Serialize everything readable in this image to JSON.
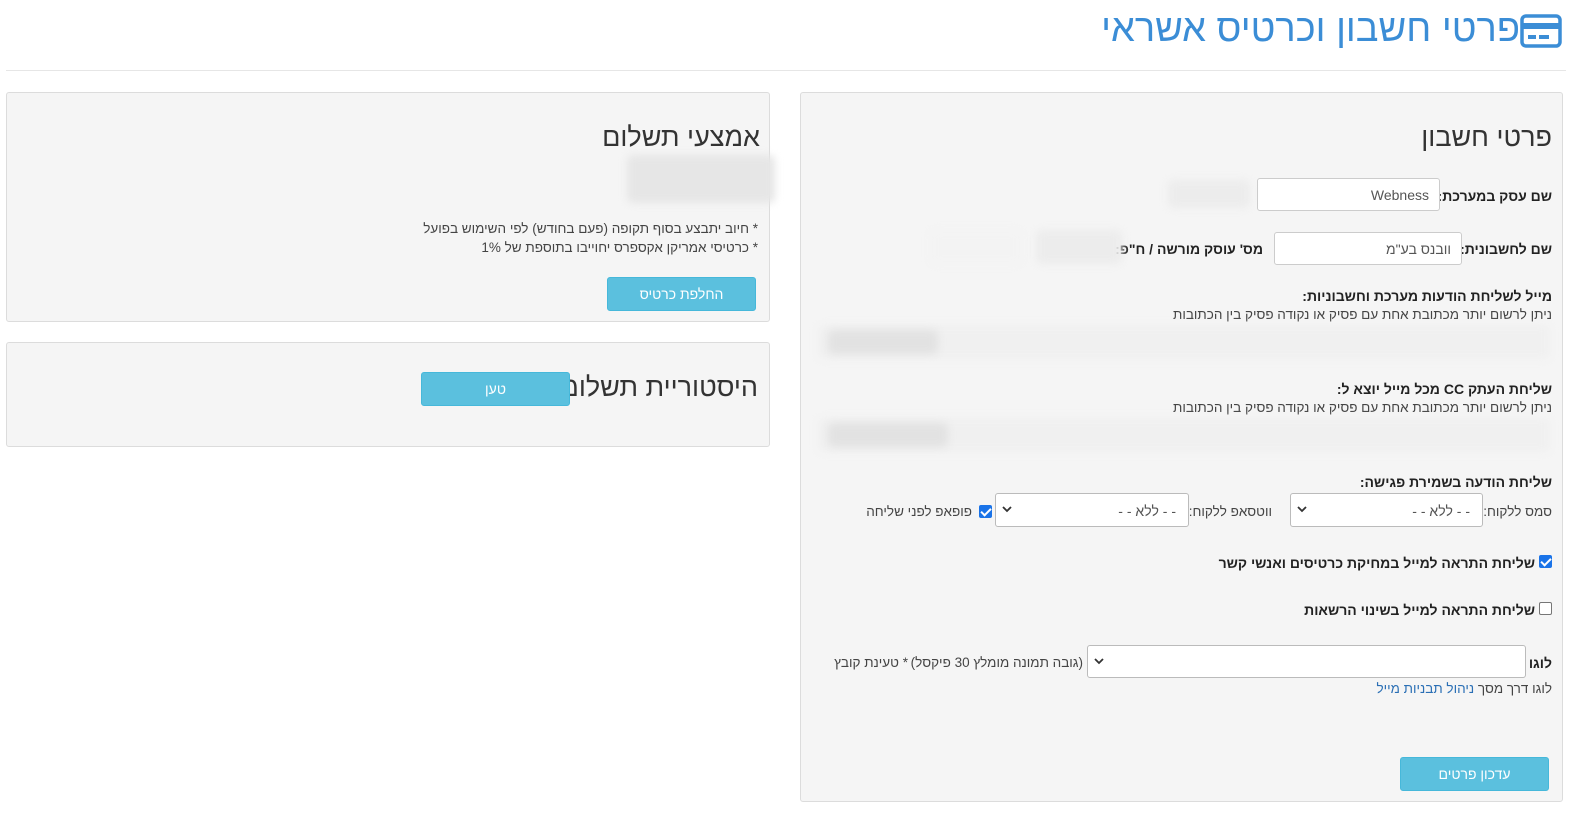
{
  "header": {
    "title": "פרטי חשבון וכרטיס אשראי",
    "icon": "credit-card-icon",
    "accent_color": "#3b8dd6"
  },
  "account_panel": {
    "title": "פרטי חשבון",
    "business_name_label": "שם עסק במערכת:",
    "business_name_value": "Webness",
    "invoice_name_label": "שם לחשבונית:",
    "invoice_name_value": "וובנס בע\"מ",
    "tax_id_label": "מס' עוסק מורשה / ח\"פ:",
    "system_mail_label": "מייל לשליחת הודעות מערכת וחשבוניות:",
    "system_mail_hint": "ניתן לרשום יותר מכתובת אחת עם פסיק או נקודה פסיק בין הכתובות",
    "cc_label": "שליחת העתק CC מכל מייל יוצא ל:",
    "cc_hint": "ניתן לרשום יותר מכתובת אחת עם פסיק או נקודה פסיק בין הכתובות",
    "meeting_notice_label": "שליחת הודעה בשמירת פגישה:",
    "sms_label": "סמס ללקוח:",
    "sms_value": "- - ללא - -",
    "whatsapp_label": "ווטסאפ ללקוח:",
    "whatsapp_value": "- - ללא - -",
    "popup_label": "פופאפ לפני שליחה",
    "popup_checked": true,
    "delete_alert_label": "שליחת התראה למייל במחיקת כרטיסים ואנשי קשר",
    "delete_alert_checked": true,
    "permissions_alert_label": "שליחת התראה למייל בשינוי הרשאות",
    "permissions_alert_checked": false,
    "logo_label": "לוגו",
    "logo_hint": "(גובה תמונה מומלץ 30 פיקסל)",
    "logo_upload": "* טעינת קובץ",
    "logo_mail_prefix": "לוגו דרך מסך",
    "logo_mail_link": "ניהול תבניות מייל",
    "update_button": "עדכון פרטים"
  },
  "payment_panel": {
    "title": "אמצעי תשלום",
    "note1": "* חיוב יתבצע בסוף תקופה (פעם בחודש) לפי השימוש בפועל",
    "note2": "* כרטיסי אמריקן אקספרס יחוייבו בתוספת של 1%",
    "change_card_button": "החלפת כרטיס"
  },
  "history_panel": {
    "title": "היסטוריית תשלומים",
    "load_button": "טען"
  }
}
